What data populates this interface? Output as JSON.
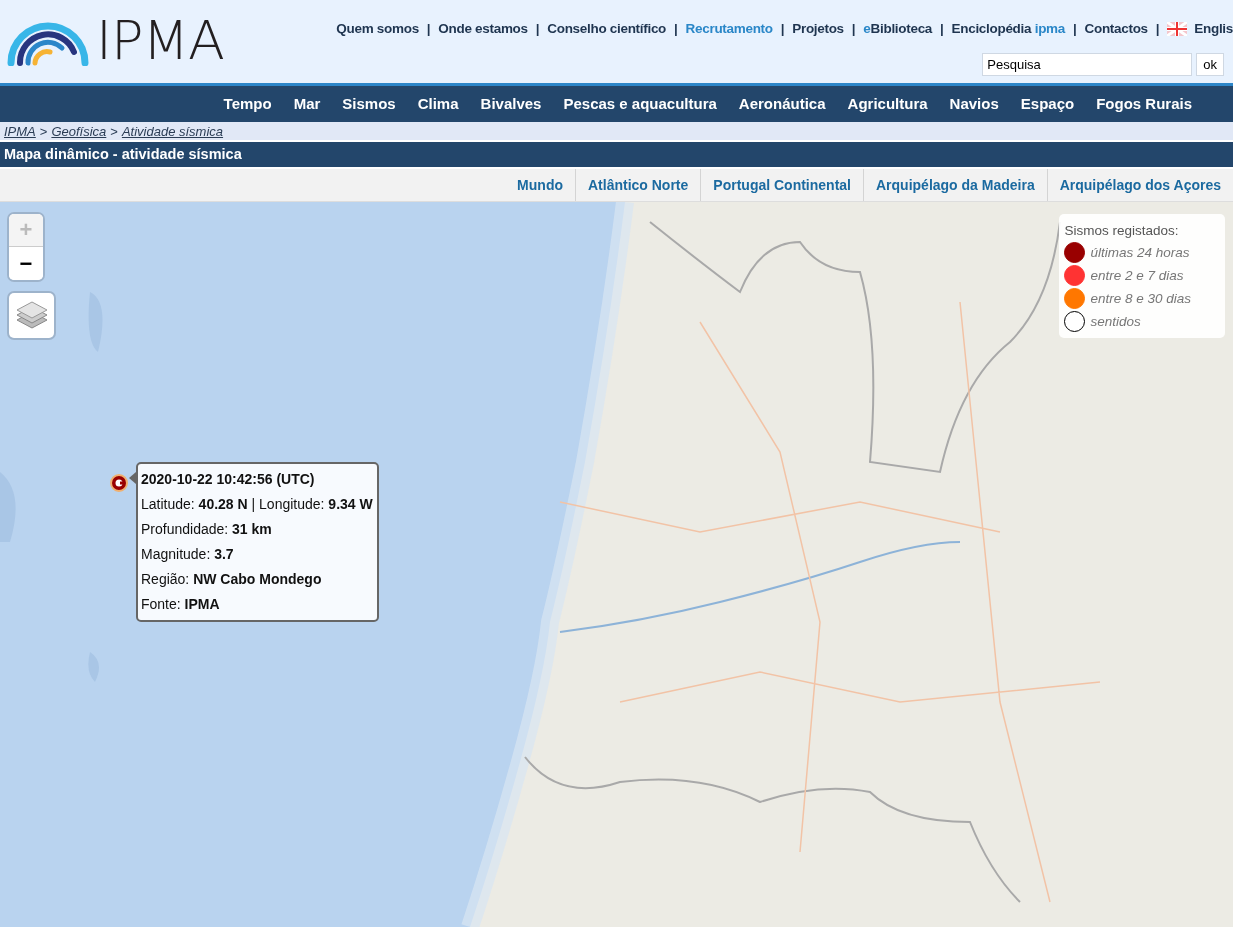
{
  "header": {
    "logo": "IPMA",
    "top_links": [
      {
        "parts": [
          {
            "text": "Quem somos",
            "accent": false
          }
        ],
        "separator": "|"
      },
      {
        "parts": [
          {
            "text": "Onde estamos",
            "accent": false
          }
        ],
        "separator": "|"
      },
      {
        "parts": [
          {
            "text": "Conselho científico",
            "accent": false
          }
        ],
        "separator": "|"
      },
      {
        "parts": [
          {
            "text": "Recrutamento",
            "accent": true
          }
        ],
        "separator": "|"
      },
      {
        "parts": [
          {
            "text": "Projetos",
            "accent": false
          }
        ],
        "separator": "|"
      },
      {
        "parts": [
          {
            "text": "e",
            "accent": true
          },
          {
            "text": "Biblioteca",
            "accent": false
          }
        ],
        "separator": "|"
      },
      {
        "parts": [
          {
            "text": "Enciclopédia ",
            "accent": false
          },
          {
            "text": "ipma",
            "accent": true
          }
        ],
        "separator": "|"
      },
      {
        "parts": [
          {
            "text": "Contactos",
            "accent": false
          }
        ],
        "separator": "|"
      }
    ],
    "language": "Englis",
    "search": {
      "value": "Pesquisa",
      "button": "ok"
    }
  },
  "main_nav": [
    "Tempo",
    "Mar",
    "Sismos",
    "Clima",
    "Bivalves",
    "Pescas e aquacultura",
    "Aeronáutica",
    "Agricultura",
    "Navios",
    "Espaço",
    "Fogos Rurais"
  ],
  "breadcrumb": [
    {
      "label": "IPMA"
    },
    {
      "separator": ">",
      "label": "Geofísica"
    },
    {
      "separator": ">",
      "label": "Atividade sísmica"
    }
  ],
  "page_title": "Mapa dinâmico - atividade sísmica",
  "region_tabs": [
    "Mundo",
    "Atlântico Norte",
    "Portugal Continental",
    "Arquipélago da Madeira",
    "Arquipélago dos Açores"
  ],
  "map": {
    "zoom_in": "+",
    "zoom_out": "−",
    "legend": {
      "title": "Sismos registados:",
      "items": [
        {
          "label": "últimas 24 horas",
          "color": "#990000"
        },
        {
          "label": "entre 2 e 7 dias",
          "color": "#ff3333"
        },
        {
          "label": "entre 8 e 30 dias",
          "color": "#ff7700"
        },
        {
          "label": "sentidos",
          "color": "#ffffff"
        }
      ]
    },
    "popup": {
      "title": "2020-10-22 10:42:56 (UTC)",
      "lines": [
        "Latitude: **40.28 N** | Longitude: **9.34 W**",
        "Profundidade: **31 km**",
        "Magnitude: **3.7**",
        "Região: **NW Cabo Mondego**",
        "Fonte: **IPMA**"
      ]
    }
  }
}
